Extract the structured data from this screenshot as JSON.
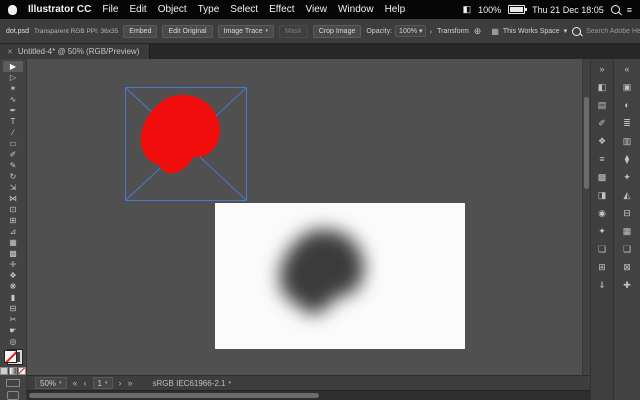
{
  "menu_bar": {
    "app_name": "Illustrator CC",
    "items": [
      "File",
      "Edit",
      "Object",
      "Type",
      "Select",
      "Effect",
      "View",
      "Window",
      "Help"
    ],
    "tray_icon_glyph": "◧",
    "battery_percent": "100%",
    "clock": "Thu 21 Dec 18:05",
    "notification_icon_glyph": "≡"
  },
  "control_bar": {
    "file_name": "dot.psd",
    "file_info": "Transparent RGB    PPI: 36x35",
    "embed_label": "Embed",
    "edit_original_label": "Edit Original",
    "image_trace_label": "Image Trace",
    "image_trace_arrow": "▾",
    "mask_label": "Mask",
    "crop_image_label": "Crop Image",
    "opacity_label": "Opacity:",
    "opacity_value": "100%",
    "opacity_arrow": "▾",
    "panel_arrow": "›",
    "transform_label": "Transform",
    "free_transform_icon_glyph": "⊕",
    "workspace_icon_glyph": "▦",
    "workspace_label": "This Works Space",
    "workspace_arrow": "▾",
    "search_placeholder": "Search Adobe Help"
  },
  "document_tab": {
    "close_glyph": "✕",
    "title": "Untitled-4* @ 50% (RGB/Preview)"
  },
  "tools": [
    {
      "name": "selection-tool",
      "glyph": "▶",
      "active": true
    },
    {
      "name": "direct-selection-tool",
      "glyph": "▷"
    },
    {
      "name": "magic-wand-tool",
      "glyph": "✶"
    },
    {
      "name": "lasso-tool",
      "glyph": "∿"
    },
    {
      "name": "pen-tool",
      "glyph": "✒"
    },
    {
      "name": "type-tool",
      "glyph": "T"
    },
    {
      "name": "line-segment-tool",
      "glyph": "∕"
    },
    {
      "name": "rectangle-tool",
      "glyph": "▭"
    },
    {
      "name": "paintbrush-tool",
      "glyph": "✐"
    },
    {
      "name": "pencil-tool",
      "glyph": "✎"
    },
    {
      "name": "rotate-tool",
      "glyph": "↻"
    },
    {
      "name": "scale-tool",
      "glyph": "⇲"
    },
    {
      "name": "width-tool",
      "glyph": "⋈"
    },
    {
      "name": "free-transform-tool",
      "glyph": "⊡"
    },
    {
      "name": "shape-builder-tool",
      "glyph": "⊞"
    },
    {
      "name": "perspective-grid-tool",
      "glyph": "⊿"
    },
    {
      "name": "mesh-tool",
      "glyph": "▦"
    },
    {
      "name": "gradient-tool",
      "glyph": "▩"
    },
    {
      "name": "eyedropper-tool",
      "glyph": "✛"
    },
    {
      "name": "blend-tool",
      "glyph": "❖"
    },
    {
      "name": "symbol-sprayer-tool",
      "glyph": "❋"
    },
    {
      "name": "column-graph-tool",
      "glyph": "▮"
    },
    {
      "name": "artboard-tool",
      "glyph": "⊟"
    },
    {
      "name": "slice-tool",
      "glyph": "✂"
    },
    {
      "name": "hand-tool",
      "glyph": "☛"
    },
    {
      "name": "zoom-tool",
      "glyph": "◎"
    }
  ],
  "dock_a": [
    {
      "name": "collapse-dock-icon",
      "glyph": "»"
    },
    {
      "name": "color-panel-icon",
      "glyph": "◧"
    },
    {
      "name": "swatches-panel-icon",
      "glyph": "▤"
    },
    {
      "name": "brushes-panel-icon",
      "glyph": "✐"
    },
    {
      "name": "symbols-panel-icon",
      "glyph": "❖"
    },
    {
      "name": "stroke-panel-icon",
      "glyph": "≡"
    },
    {
      "name": "gradient-panel-icon",
      "glyph": "▩"
    },
    {
      "name": "transparency-panel-icon",
      "glyph": "◨"
    },
    {
      "name": "appearance-panel-icon",
      "glyph": "◉"
    },
    {
      "name": "graphic-styles-panel-icon",
      "glyph": "✦"
    },
    {
      "name": "layers-panel-icon",
      "glyph": "❏"
    },
    {
      "name": "artboards-panel-icon",
      "glyph": "⊞"
    },
    {
      "name": "asset-export-panel-icon",
      "glyph": "⇓"
    }
  ],
  "dock_b": [
    {
      "name": "collapse-dock-icon",
      "glyph": "«"
    },
    {
      "name": "libraries-panel-icon",
      "glyph": "▣"
    },
    {
      "name": "adjustments-panel-icon",
      "glyph": "◐"
    },
    {
      "name": "info-panel-icon",
      "glyph": "≣"
    },
    {
      "name": "links-panel-icon",
      "glyph": "▥"
    },
    {
      "name": "align-panel-icon",
      "glyph": "⧫"
    },
    {
      "name": "pathfinder-panel-icon",
      "glyph": "✦"
    },
    {
      "name": "navigator-panel-icon",
      "glyph": "◭"
    },
    {
      "name": "character-panel-icon",
      "glyph": "⊟"
    },
    {
      "name": "paragraph-panel-icon",
      "glyph": "▦"
    },
    {
      "name": "glyphs-panel-icon",
      "glyph": "❑"
    },
    {
      "name": "actions-panel-icon",
      "glyph": "⊠"
    },
    {
      "name": "plus-panel-icon",
      "glyph": "✚"
    }
  ],
  "status_bar": {
    "zoom_value": "50%",
    "zoom_arrow": "▾",
    "nav_first": "«",
    "nav_prev": "‹",
    "artboard_number": "1",
    "artboard_arrow": "▾",
    "nav_next": "›",
    "nav_last": "»",
    "color_profile": "sRGB IEC61966-2.1",
    "profile_arrow": "▾"
  },
  "colors": {
    "selection_blue": "#4a78d0",
    "dot_red": "#f20d0d",
    "dot_gray": "#3b3b3b"
  }
}
